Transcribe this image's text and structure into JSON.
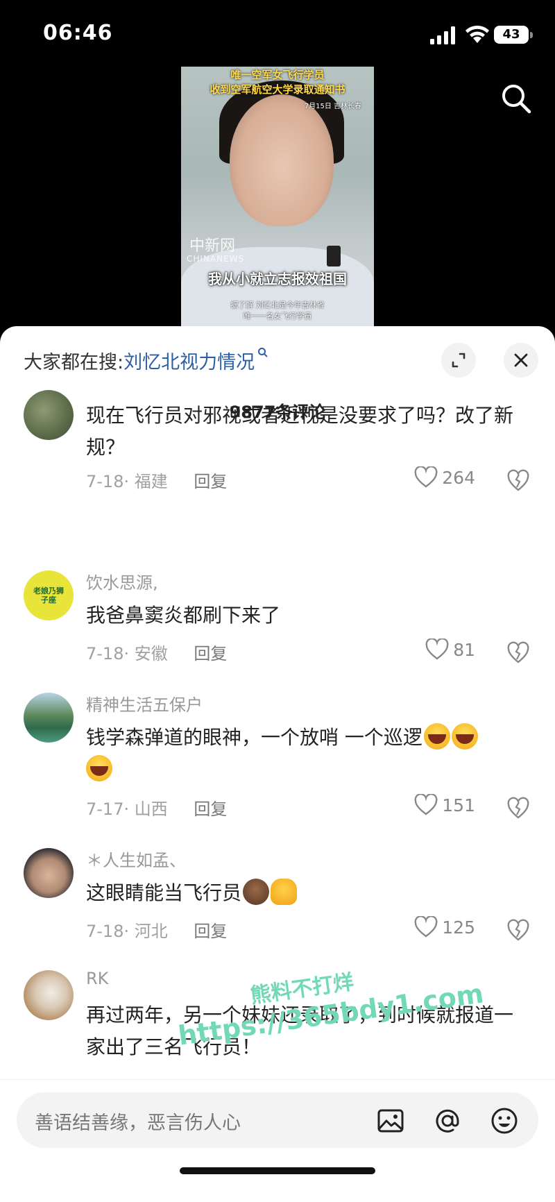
{
  "status_bar": {
    "time": "06:46",
    "battery": "43"
  },
  "video": {
    "title_line1": "唯一空军女飞行学员",
    "title_line2": "收到空军航空大学录取通知书",
    "date": "7月15日 吉林长春",
    "logo": "中新网",
    "logo_en": "CHINANEWS",
    "caption": "我从小就立志报效祖国",
    "sub_line1": "据了解 刘忆北是今年吉林省",
    "sub_line2": "唯一一名女飞行学员"
  },
  "trending": {
    "prefix": "大家都在搜:",
    "keyword": "刘忆北视力情况"
  },
  "comment_count": "9877条评论",
  "comments": [
    {
      "username": "",
      "text": "现在飞行员对邪视或者近视是没要求了吗？改了新规？",
      "date": "7-18",
      "location": "福建",
      "likes": "264",
      "reply": "回复"
    },
    {
      "username": "饮水思源,",
      "text": "我爸鼻窦炎都刷下来了",
      "date": "7-18",
      "location": "安徽",
      "likes": "81",
      "reply": "回复",
      "avatar_text": "老娘乃狮子座"
    },
    {
      "username": "精神生活五保户",
      "text": "钱学森弹道的眼神，一个放哨  一个巡逻",
      "date": "7-17",
      "location": "山西",
      "likes": "151",
      "reply": "回复"
    },
    {
      "username": "＊人生如孟、",
      "text": "这眼睛能当飞行员",
      "date": "7-18",
      "location": "河北",
      "likes": "125",
      "reply": "回复"
    },
    {
      "username": "RK",
      "text": "再过两年，另一个妹妹还录取了，到时候就报道一家出了三名飞行员！",
      "date": "",
      "location": "",
      "likes": "",
      "reply": ""
    }
  ],
  "watermark": {
    "line1": "熊料不打烊",
    "line2": "https://365bdy1.com"
  },
  "input": {
    "placeholder": "善语结善缘，恶言伤人心"
  },
  "icons": [
    "search-icon",
    "expand-icon",
    "close-icon",
    "heart-icon",
    "dislike-icon",
    "image-icon",
    "at-icon",
    "emoji-icon"
  ]
}
